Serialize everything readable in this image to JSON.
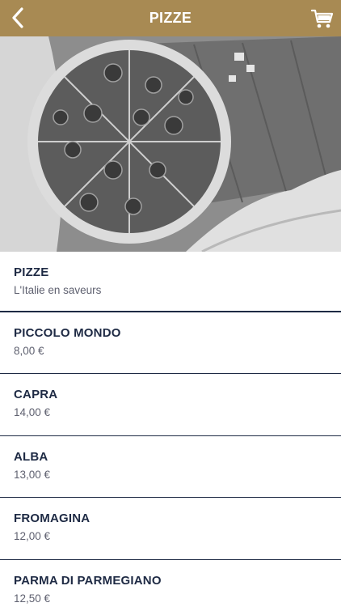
{
  "header": {
    "title": "PIZZE",
    "back_icon": "chevron-left-icon",
    "cart_icon": "cart-icon",
    "bar_color": "#a88a53"
  },
  "section": {
    "title": "PIZZE",
    "subtitle": "L'Italie en saveurs"
  },
  "items": [
    {
      "name": "PICCOLO MONDO",
      "price": "8,00 €"
    },
    {
      "name": "CAPRA",
      "price": "14,00 €"
    },
    {
      "name": "ALBA",
      "price": "13,00 €"
    },
    {
      "name": "FROMAGINA",
      "price": "12,00 €"
    },
    {
      "name": "PARMA DI PARMEGIANO",
      "price": "12,50 €"
    }
  ],
  "colors": {
    "accent": "#a88a53",
    "text_dark": "#1e2a44",
    "text_muted": "#5f6170"
  }
}
